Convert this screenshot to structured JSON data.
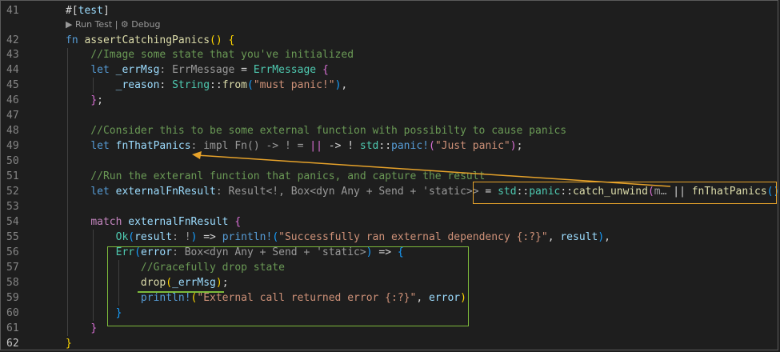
{
  "codelens": "▶ Run Test | ⚙ Debug",
  "lines": [
    {
      "num": "41",
      "tokens": [
        {
          "t": "#[",
          "c": "op"
        },
        {
          "t": "test",
          "c": "var"
        },
        {
          "t": "]",
          "c": "op"
        }
      ]
    },
    {
      "num": "42",
      "tokens": [
        {
          "t": "fn",
          "c": "kw"
        },
        {
          "t": " ",
          "c": "op"
        },
        {
          "t": "assertCatchingPanics",
          "c": "fn"
        },
        {
          "t": "()",
          "c": "br1"
        },
        {
          "t": " ",
          "c": "op"
        },
        {
          "t": "{",
          "c": "br1"
        }
      ]
    },
    {
      "num": "43",
      "tokens": [
        {
          "t": "    //Image some state that you've initialized",
          "c": "cm"
        }
      ]
    },
    {
      "num": "44",
      "tokens": [
        {
          "t": "    ",
          "c": "op"
        },
        {
          "t": "let",
          "c": "kw"
        },
        {
          "t": " ",
          "c": "op"
        },
        {
          "t": "_errMsg",
          "c": "var"
        },
        {
          "t": ": ErrMessage",
          "c": "hint"
        },
        {
          "t": " = ",
          "c": "op"
        },
        {
          "t": "ErrMessage",
          "c": "ty"
        },
        {
          "t": " ",
          "c": "op"
        },
        {
          "t": "{",
          "c": "br2"
        }
      ]
    },
    {
      "num": "45",
      "tokens": [
        {
          "t": "        ",
          "c": "op"
        },
        {
          "t": "_reason",
          "c": "var"
        },
        {
          "t": ": ",
          "c": "op"
        },
        {
          "t": "String",
          "c": "ty"
        },
        {
          "t": "::",
          "c": "op"
        },
        {
          "t": "from",
          "c": "fn"
        },
        {
          "t": "(",
          "c": "br3"
        },
        {
          "t": "\"must panic!\"",
          "c": "str"
        },
        {
          "t": ")",
          "c": "br3"
        },
        {
          "t": ",",
          "c": "op"
        }
      ]
    },
    {
      "num": "46",
      "tokens": [
        {
          "t": "    ",
          "c": "op"
        },
        {
          "t": "}",
          "c": "br2"
        },
        {
          "t": ";",
          "c": "op"
        }
      ]
    },
    {
      "num": "47",
      "tokens": []
    },
    {
      "num": "48",
      "tokens": [
        {
          "t": "    //Consider this to be some external function with possibilty to cause panics",
          "c": "cm"
        }
      ]
    },
    {
      "num": "49",
      "tokens": [
        {
          "t": "    ",
          "c": "op"
        },
        {
          "t": "let",
          "c": "kw"
        },
        {
          "t": " ",
          "c": "op"
        },
        {
          "t": "fnThatPanics",
          "c": "var"
        },
        {
          "t": ": impl Fn() -> ! =",
          "c": "hint"
        },
        {
          "t": " ",
          "c": "op"
        },
        {
          "t": "||",
          "c": "br2"
        },
        {
          "t": " -> ! ",
          "c": "op"
        },
        {
          "t": "std",
          "c": "ty"
        },
        {
          "t": "::",
          "c": "op"
        },
        {
          "t": "panic!",
          "c": "mac"
        },
        {
          "t": "(",
          "c": "br2"
        },
        {
          "t": "\"Just panic\"",
          "c": "str"
        },
        {
          "t": ")",
          "c": "br2"
        },
        {
          "t": ";",
          "c": "op"
        }
      ]
    },
    {
      "num": "50",
      "tokens": []
    },
    {
      "num": "51",
      "tokens": [
        {
          "t": "    //Run the exteranl function that panics, and capture the result",
          "c": "cm"
        }
      ]
    },
    {
      "num": "52",
      "tokens": [
        {
          "t": "    ",
          "c": "op"
        },
        {
          "t": "let",
          "c": "kw"
        },
        {
          "t": " ",
          "c": "op"
        },
        {
          "t": "externalFnResult",
          "c": "var"
        },
        {
          "t": ": Result<!, Box<dyn Any + Send + 'static>>",
          "c": "hint"
        },
        {
          "t": " = ",
          "c": "op"
        },
        {
          "t": "std",
          "c": "ty"
        },
        {
          "t": "::",
          "c": "op"
        },
        {
          "t": "panic",
          "c": "ty"
        },
        {
          "t": "::",
          "c": "op"
        },
        {
          "t": "catch_unwind",
          "c": "fn"
        },
        {
          "t": "(",
          "c": "br2"
        },
        {
          "t": "m…",
          "c": "hint"
        },
        {
          "t": " || ",
          "c": "op"
        },
        {
          "t": "fnThatPanics",
          "c": "fn"
        },
        {
          "t": "()",
          "c": "br3"
        },
        {
          "t": ")",
          "c": "br2"
        },
        {
          "t": ";",
          "c": "op"
        }
      ]
    },
    {
      "num": "53",
      "tokens": []
    },
    {
      "num": "54",
      "tokens": [
        {
          "t": "    ",
          "c": "op"
        },
        {
          "t": "match",
          "c": "ctl"
        },
        {
          "t": " ",
          "c": "op"
        },
        {
          "t": "externalFnResult",
          "c": "var"
        },
        {
          "t": " ",
          "c": "op"
        },
        {
          "t": "{",
          "c": "br2"
        }
      ]
    },
    {
      "num": "55",
      "tokens": [
        {
          "t": "        ",
          "c": "op"
        },
        {
          "t": "Ok",
          "c": "ty"
        },
        {
          "t": "(",
          "c": "br3"
        },
        {
          "t": "result",
          "c": "var"
        },
        {
          "t": ": !",
          "c": "hint"
        },
        {
          "t": ")",
          "c": "br3"
        },
        {
          "t": " => ",
          "c": "op"
        },
        {
          "t": "println!",
          "c": "mac"
        },
        {
          "t": "(",
          "c": "br3"
        },
        {
          "t": "\"Successfully ran external dependency {:?}\"",
          "c": "str"
        },
        {
          "t": ", ",
          "c": "op"
        },
        {
          "t": "result",
          "c": "var"
        },
        {
          "t": ")",
          "c": "br3"
        },
        {
          "t": ",",
          "c": "op"
        }
      ]
    },
    {
      "num": "56",
      "tokens": [
        {
          "t": "        ",
          "c": "op"
        },
        {
          "t": "Err",
          "c": "ty"
        },
        {
          "t": "(",
          "c": "br3"
        },
        {
          "t": "error",
          "c": "var"
        },
        {
          "t": ": Box<dyn Any + Send + 'static>",
          "c": "hint"
        },
        {
          "t": ")",
          "c": "br3"
        },
        {
          "t": " => ",
          "c": "op"
        },
        {
          "t": "{",
          "c": "br3"
        }
      ]
    },
    {
      "num": "57",
      "tokens": [
        {
          "t": "            //Gracefully drop state",
          "c": "cm"
        }
      ]
    },
    {
      "num": "58",
      "tokens": [
        {
          "t": "            ",
          "c": "op"
        },
        {
          "t": "drop",
          "c": "fn"
        },
        {
          "t": "(",
          "c": "br1"
        },
        {
          "t": "_errMsg",
          "c": "var"
        },
        {
          "t": ")",
          "c": "br1"
        },
        {
          "t": ";",
          "c": "op"
        }
      ]
    },
    {
      "num": "59",
      "tokens": [
        {
          "t": "            ",
          "c": "op"
        },
        {
          "t": "println!",
          "c": "mac"
        },
        {
          "t": "(",
          "c": "br1"
        },
        {
          "t": "\"External call returned error {:?}\"",
          "c": "str"
        },
        {
          "t": ", ",
          "c": "op"
        },
        {
          "t": "error",
          "c": "var"
        },
        {
          "t": ")",
          "c": "br1"
        }
      ]
    },
    {
      "num": "60",
      "tokens": [
        {
          "t": "        ",
          "c": "op"
        },
        {
          "t": "}",
          "c": "br3"
        }
      ]
    },
    {
      "num": "61",
      "tokens": [
        {
          "t": "    ",
          "c": "op"
        },
        {
          "t": "}",
          "c": "br2"
        }
      ]
    },
    {
      "num": "62",
      "tokens": [
        {
          "t": "}",
          "c": "br1"
        }
      ]
    }
  ],
  "active_line": "62",
  "annotations": {
    "arrow_color": "#e6a22a",
    "highlight_orange": "#e6a22a",
    "highlight_green": "#7db93b"
  }
}
